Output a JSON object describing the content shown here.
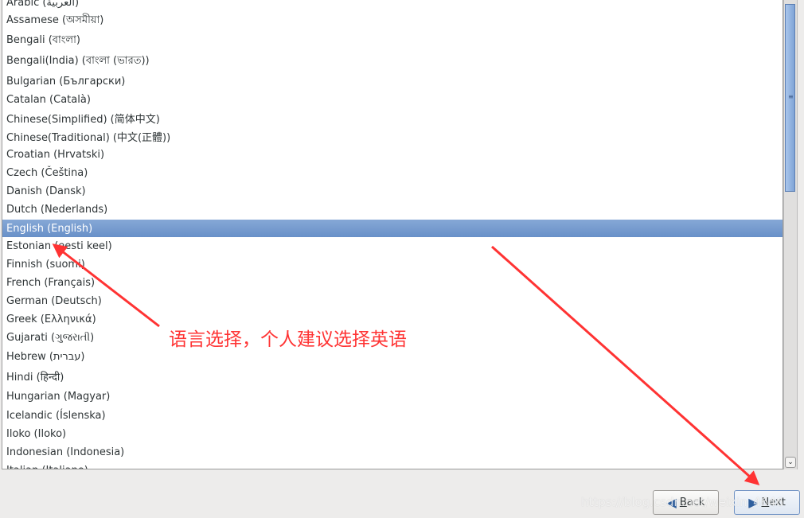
{
  "language_list": {
    "selected": "English (English)",
    "items": [
      "Arabic (العربية)",
      "Assamese (অসমীয়া)",
      "Bengali (বাংলা)",
      "Bengali(India) (বাংলা (ভারত))",
      "Bulgarian (Български)",
      "Catalan (Català)",
      "Chinese(Simplified) (简体中文)",
      "Chinese(Traditional) (中文(正體))",
      "Croatian (Hrvatski)",
      "Czech (Čeština)",
      "Danish (Dansk)",
      "Dutch (Nederlands)",
      "English (English)",
      "Estonian (eesti keel)",
      "Finnish (suomi)",
      "French (Français)",
      "German (Deutsch)",
      "Greek (Ελληνικά)",
      "Gujarati (ગુજરાતી)",
      "Hebrew (עברית)",
      "Hindi (हिन्दी)",
      "Hungarian (Magyar)",
      "Icelandic (Íslenska)",
      "Iloko (Iloko)",
      "Indonesian (Indonesia)",
      "Italian (Italiano)"
    ]
  },
  "scrollbar": {
    "grip_icon": "grip-lines",
    "down_icon": "chevron-down"
  },
  "buttons": {
    "back": {
      "label_underlined": "B",
      "label_rest": "ack",
      "icon": "arrow-left"
    },
    "next": {
      "label_underlined": "N",
      "label_rest": "ext",
      "icon": "arrow-right"
    }
  },
  "annotation": {
    "text": "语言选择，个人建议选择英语",
    "color": "#ff3333"
  },
  "watermark": "https://blog.csdn.net/weixin_4646",
  "colors": {
    "selection": "#7298cc",
    "background": "#edeceb"
  }
}
